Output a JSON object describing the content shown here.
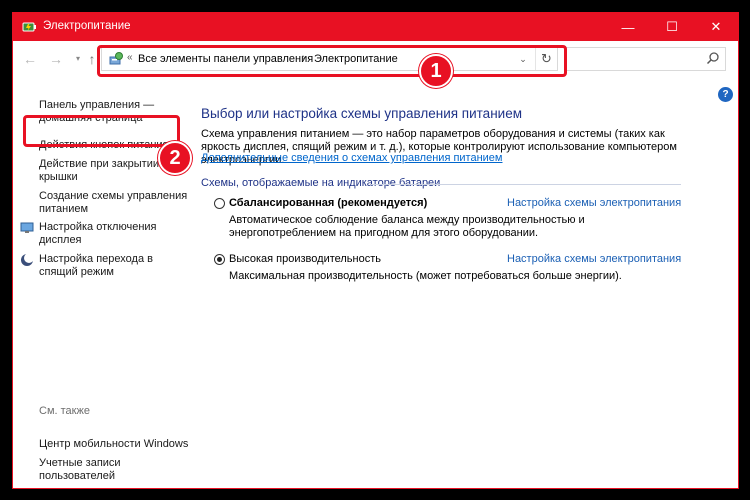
{
  "window": {
    "title": "Электропитание",
    "accent_color": "#e81123",
    "minimize_glyph": "—",
    "maximize_glyph": "☐",
    "close_glyph": "✕"
  },
  "nav": {
    "back_icon": "arrow-left-icon",
    "forward_icon": "arrow-right-icon",
    "up_icon": "arrow-up-icon",
    "breadcrumb": {
      "prefix": "«",
      "items": [
        "Все элементы панели управления",
        "Электропитание"
      ],
      "separator": "›"
    },
    "search_placeholder": ""
  },
  "sidebar": {
    "links": [
      {
        "label": "Панель управления — домашняя страница"
      },
      {
        "label": "Действия кнопок питания"
      },
      {
        "label": "Действие при закрытии крышки"
      },
      {
        "label": "Создание схемы управления питанием"
      },
      {
        "label": "Настройка отключения дисплея",
        "icon": "monitor-icon"
      },
      {
        "label": "Настройка перехода в спящий режим",
        "icon": "moon-icon"
      }
    ],
    "see_also_heading": "См. также",
    "see_also": [
      {
        "label": "Центр мобильности Windows"
      },
      {
        "label": "Учетные записи пользователей"
      }
    ]
  },
  "main": {
    "title": "Выбор или настройка схемы управления питанием",
    "description": "Схема управления питанием — это набор параметров оборудования и системы (таких как яркость дисплея, спящий режим и т. д.), которые контролируют использование компьютером электроэнергии.",
    "more_link": "Дополнительные сведения о схемах управления питанием",
    "group_label": "Схемы, отображаемые на индикаторе батареи",
    "plans": [
      {
        "name": "Сбалансированная (рекомендуется)",
        "selected": false,
        "config_link": "Настройка схемы электропитания",
        "description": "Автоматическое соблюдение баланса между производительностью и энергопотреблением на пригодном для этого оборудовании."
      },
      {
        "name": "Высокая производительность",
        "selected": true,
        "config_link": "Настройка схемы электропитания",
        "description": "Максимальная производительность (может потребоваться больше энергии)."
      }
    ]
  },
  "annotations": {
    "badge_1": "1",
    "badge_2": "2"
  },
  "help_label": "?"
}
